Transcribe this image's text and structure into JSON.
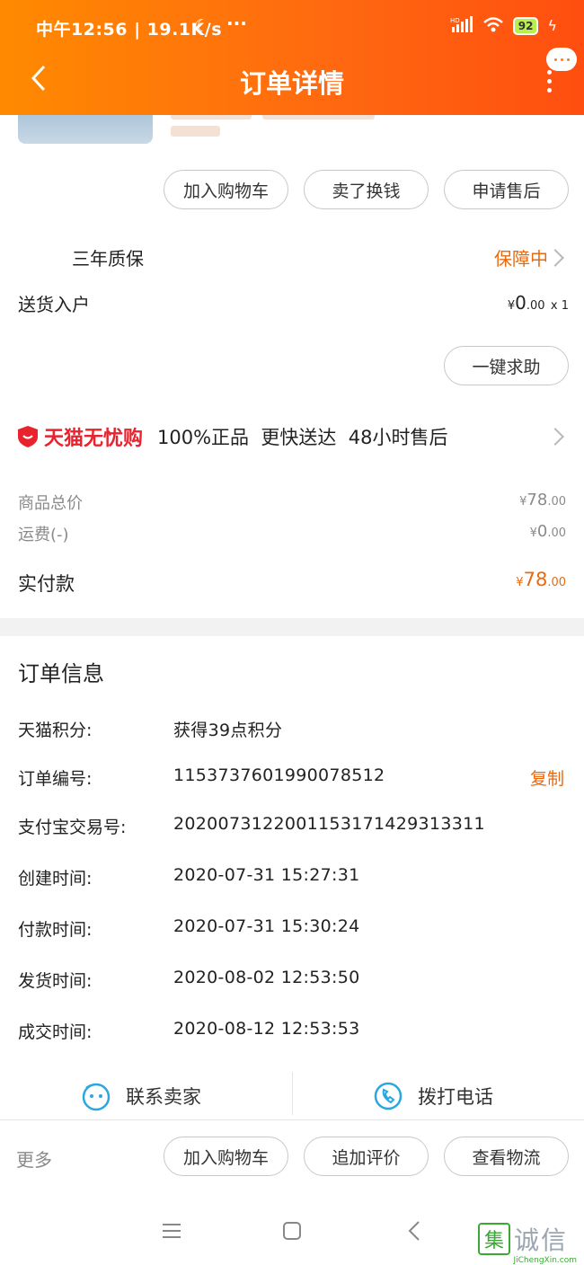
{
  "status_bar": {
    "time_speed": "中午12:56 | 19.1K/s",
    "battery": "92"
  },
  "header": {
    "title": "订单详情"
  },
  "product_actions": {
    "add_to_cart": "加入购物车",
    "sell_for_cash": "卖了换钱",
    "after_sale": "申请售后"
  },
  "warranty": {
    "name": "三年质保",
    "status": "保障中"
  },
  "delivery": {
    "name": "送货入户",
    "currency": "¥",
    "price_int": "0",
    "price_dec": ".00",
    "qty": "x 1",
    "help_button": "一键求助"
  },
  "tmall_banner": {
    "brand": "天猫无忧购",
    "features": "100%正品  更快送达  48小时售后"
  },
  "price_summary": {
    "goods_total_label": "商品总价",
    "goods_total_currency": "¥",
    "goods_total_int": "78",
    "goods_total_dec": ".00",
    "shipping_label": "运费(-)",
    "shipping_currency": "¥",
    "shipping_int": "0",
    "shipping_dec": ".00",
    "paid_label": "实付款",
    "paid_currency": "¥",
    "paid_int": "78",
    "paid_dec": ".00"
  },
  "order_info": {
    "title": "订单信息",
    "rows": [
      {
        "label": "天猫积分:",
        "value": "获得39点积分"
      },
      {
        "label": "订单编号:",
        "value": "1153737601990078512"
      },
      {
        "label": "支付宝交易号:",
        "value": "2020073122001153171429313311"
      },
      {
        "label": "创建时间:",
        "value": "2020-07-31 15:27:31"
      },
      {
        "label": "付款时间:",
        "value": "2020-07-31 15:30:24"
      },
      {
        "label": "发货时间:",
        "value": "2020-08-02 12:53:50"
      },
      {
        "label": "成交时间:",
        "value": "2020-08-12 12:53:53"
      }
    ],
    "copy_label": "复制"
  },
  "contact": {
    "seller": "联系卖家",
    "phone": "拨打电话"
  },
  "bottom_bar": {
    "more": "更多",
    "add_to_cart": "加入购物车",
    "add_review": "追加评价",
    "view_logistics": "查看物流"
  },
  "watermark": {
    "text": "诚信",
    "box": "集",
    "url": "JiChengXin.com"
  },
  "colors": {
    "accent": "#e86a10",
    "header_start": "#ff8a00",
    "header_end": "#ff4e10",
    "tmall_red": "#e8232e"
  }
}
